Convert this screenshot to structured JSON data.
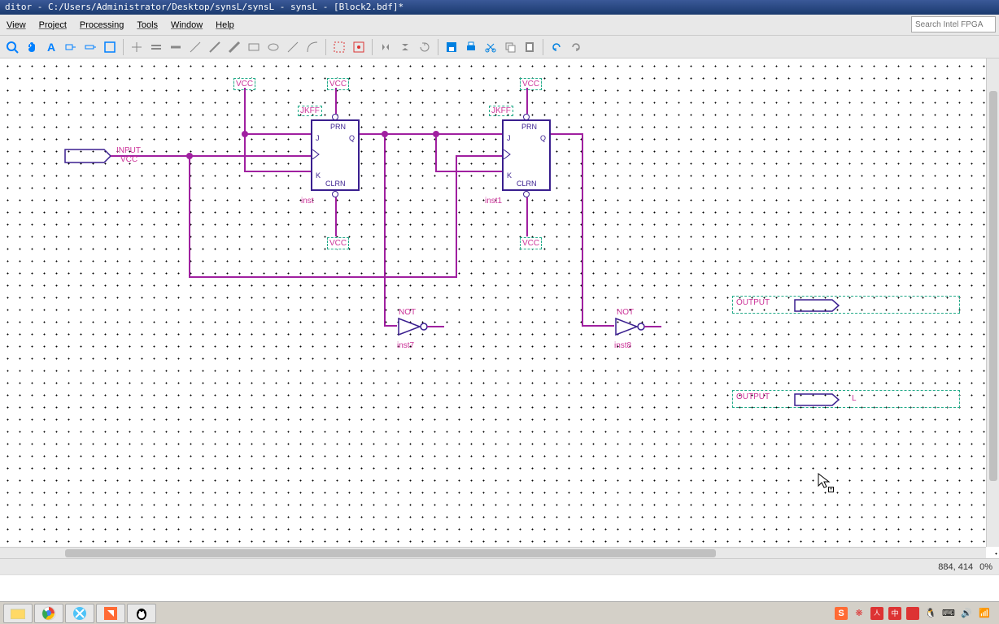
{
  "title": "ditor - C:/Users/Administrator/Desktop/synsL/synsL - synsL - [Block2.bdf]*",
  "menu": {
    "view": "View",
    "project": "Project",
    "processing": "Processing",
    "tools": "Tools",
    "window": "Window",
    "help": "Help"
  },
  "search": {
    "placeholder": "Search Intel FPGA"
  },
  "labels": {
    "vcc1": "VCC",
    "vcc2": "VCC",
    "vcc3": "VCC",
    "vcc4": "VCC",
    "vcc5": "VCC",
    "vcc6": "VCC",
    "jkff1": "JKFF",
    "jkff2": "JKFF",
    "not1": "NOT",
    "not2": "NOT",
    "inst1": "inst",
    "inst2": "inst1",
    "inst3": "inst7",
    "inst4": "inst8",
    "input": "INPUT",
    "output1": "OUTPUT",
    "output2": "OUTPUT",
    "outlabel": "L",
    "prn": "PRN",
    "clrn": "CLRN",
    "j": "J",
    "k": "K",
    "q": "Q"
  },
  "status": {
    "coords": "884, 414",
    "zoom": "0%"
  }
}
